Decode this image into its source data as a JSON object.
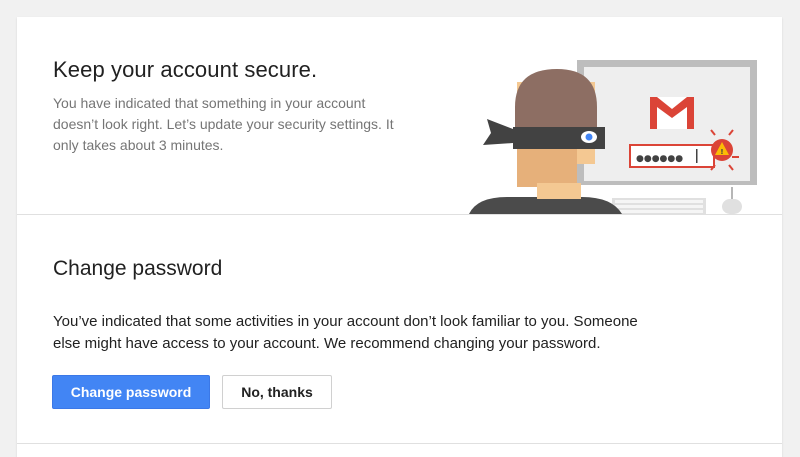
{
  "header": {
    "title": "Keep your account secure.",
    "description": "You have indicated that something in your account doesn’t look right. Let’s update your security settings. It only takes about 3 minutes."
  },
  "illustration": {
    "icon": "hacker-with-mask-at-computer-illustration",
    "password_mask": "●●●●●●",
    "warning_glyph": "!"
  },
  "change_password": {
    "title": "Change password",
    "description": "You’ve indicated that some activities in your account don’t look familiar to you. Someone else might have access to your account. We recommend changing your password.",
    "primary_button": "Change password",
    "secondary_button": "No, thanks"
  },
  "colors": {
    "primary": "#4285f4",
    "warning": "#db4437",
    "background": "#f1f1f1",
    "card": "#ffffff"
  }
}
